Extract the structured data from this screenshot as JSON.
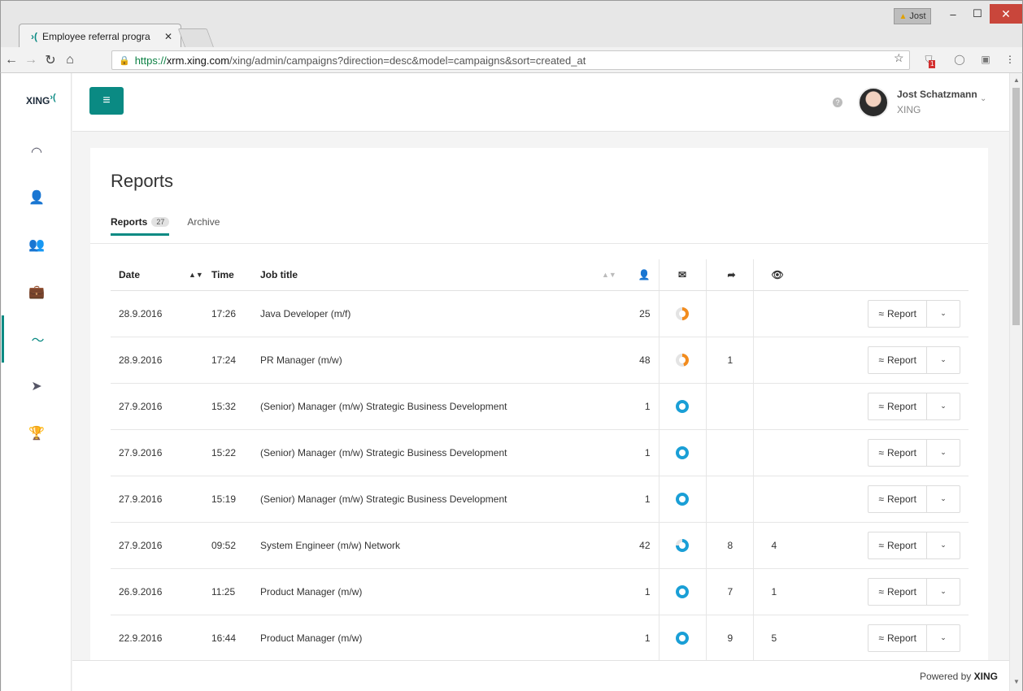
{
  "browser": {
    "tab_title": "Employee referral progra",
    "tab_favicon": "›(",
    "tab_close": "✕",
    "user_badge": "Jost",
    "url_scheme": "https://",
    "url_host": "xrm.xing.com",
    "url_path": "/xing/admin/campaigns?direction=desc&model=campaigns&sort=created_at",
    "ext_badge": "1"
  },
  "app": {
    "logo": "XING",
    "logo_mark": "›(",
    "user_name": "Jost Schatzmann",
    "user_org": "XING",
    "help_glyph": "?",
    "page_title": "Reports",
    "footer_prefix": "Powered by",
    "footer_brand": "XING"
  },
  "sidebar": {
    "items": [
      {
        "icon": "dashboard-icon",
        "glyph": "◠"
      },
      {
        "icon": "user-icon",
        "glyph": "👤"
      },
      {
        "icon": "users-icon",
        "glyph": "👥"
      },
      {
        "icon": "briefcase-icon",
        "glyph": "💼"
      },
      {
        "icon": "reports-icon",
        "glyph": "〜",
        "active": true
      },
      {
        "icon": "send-icon",
        "glyph": "➤"
      },
      {
        "icon": "trophy-icon",
        "glyph": "🏆"
      }
    ]
  },
  "tabs": {
    "reports_label": "Reports",
    "reports_count": "27",
    "archive_label": "Archive"
  },
  "table": {
    "headers": {
      "date": "Date",
      "time": "Time",
      "job_title": "Job title"
    },
    "rows": [
      {
        "date": "28.9.2016",
        "time": "17:26",
        "job": "Java Developer (m/f)",
        "count": "25",
        "pie_color": "#f28c1e",
        "pie_fraction": 0.5,
        "forwards": "",
        "views": "",
        "action": "Report"
      },
      {
        "date": "28.9.2016",
        "time": "17:24",
        "job": "PR Manager (m/w)",
        "count": "48",
        "pie_color": "#f28c1e",
        "pie_fraction": 0.45,
        "forwards": "1",
        "views": "",
        "action": "Report"
      },
      {
        "date": "27.9.2016",
        "time": "15:32",
        "job": "(Senior) Manager (m/w) Strategic Business Development",
        "count": "1",
        "pie_color": "#1a9fd6",
        "pie_fraction": 1,
        "forwards": "",
        "views": "",
        "action": "Report"
      },
      {
        "date": "27.9.2016",
        "time": "15:22",
        "job": "(Senior) Manager (m/w) Strategic Business Development",
        "count": "1",
        "pie_color": "#1a9fd6",
        "pie_fraction": 1,
        "forwards": "",
        "views": "",
        "action": "Report"
      },
      {
        "date": "27.9.2016",
        "time": "15:19",
        "job": "(Senior) Manager (m/w) Strategic Business Development",
        "count": "1",
        "pie_color": "#1a9fd6",
        "pie_fraction": 1,
        "forwards": "",
        "views": "",
        "action": "Report"
      },
      {
        "date": "27.9.2016",
        "time": "09:52",
        "job": "System Engineer (m/w) Network",
        "count": "42",
        "pie_color": "#1a9fd6",
        "pie_fraction": 0.75,
        "forwards": "8",
        "views": "4",
        "action": "Report"
      },
      {
        "date": "26.9.2016",
        "time": "11:25",
        "job": "Product Manager (m/w)",
        "count": "1",
        "pie_color": "#1a9fd6",
        "pie_fraction": 1,
        "forwards": "7",
        "views": "1",
        "action": "Report"
      },
      {
        "date": "22.9.2016",
        "time": "16:44",
        "job": "Product Manager (m/w)",
        "count": "1",
        "pie_color": "#1a9fd6",
        "pie_fraction": 1,
        "forwards": "9",
        "views": "5",
        "action": "Report"
      }
    ]
  },
  "colors": {
    "accent": "#0a8a83",
    "pie_orange": "#f28c1e",
    "pie_blue": "#1a9fd6"
  }
}
